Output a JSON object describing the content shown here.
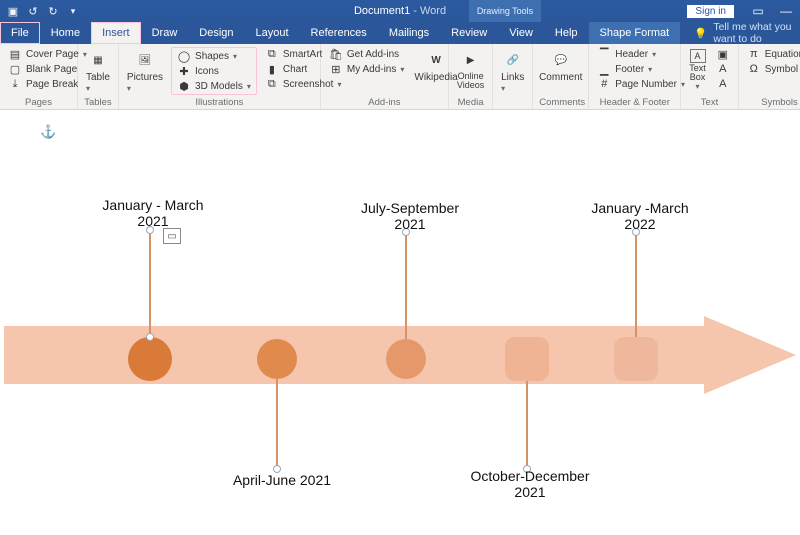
{
  "titlebar": {
    "doc_name": "Document1",
    "app_suffix": " - Word",
    "tool_context": "Drawing Tools",
    "signin": "Sign in"
  },
  "tabs": {
    "file": "File",
    "home": "Home",
    "insert": "Insert",
    "draw": "Draw",
    "design": "Design",
    "layout": "Layout",
    "references": "References",
    "mailings": "Mailings",
    "review": "Review",
    "view": "View",
    "help": "Help",
    "shape_format": "Shape Format",
    "tell_me": "Tell me what you want to do"
  },
  "ribbon": {
    "pages": {
      "label": "Pages",
      "cover_page": "Cover Page",
      "blank_page": "Blank Page",
      "page_break": "Page Break"
    },
    "tables": {
      "label": "Tables",
      "table": "Table"
    },
    "illustrations": {
      "label": "Illustrations",
      "pictures": "Pictures",
      "shapes": "Shapes",
      "icons": "Icons",
      "models": "3D Models",
      "smartart": "SmartArt",
      "chart": "Chart",
      "screenshot": "Screenshot"
    },
    "addins": {
      "label": "Add-ins",
      "get": "Get Add-ins",
      "my": "My Add-ins",
      "wikipedia": "Wikipedia"
    },
    "media": {
      "label": "Media",
      "online_videos": "Online Videos"
    },
    "links": {
      "label": "",
      "links": "Links"
    },
    "comments": {
      "label": "Comments",
      "comment": "Comment"
    },
    "header_footer": {
      "label": "Header & Footer",
      "header": "Header",
      "footer": "Footer",
      "page_number": "Page Number"
    },
    "text": {
      "label": "Text",
      "text_box": "Text Box"
    },
    "symbols": {
      "label": "Symbols",
      "equation": "Equation",
      "symbol": "Symbol"
    }
  },
  "timeline": {
    "labels": {
      "t1": "January - March 2021",
      "t2": "April-June 2021",
      "t3": "July-September 2021",
      "t4": "October-December 2021",
      "t5": "January -March 2022"
    }
  },
  "colors": {
    "arrow_fill": "#f5c6ad",
    "markers": [
      "#d97a38",
      "#e08a4e",
      "#e5996b",
      "#eeb494",
      "#efb89d"
    ]
  }
}
